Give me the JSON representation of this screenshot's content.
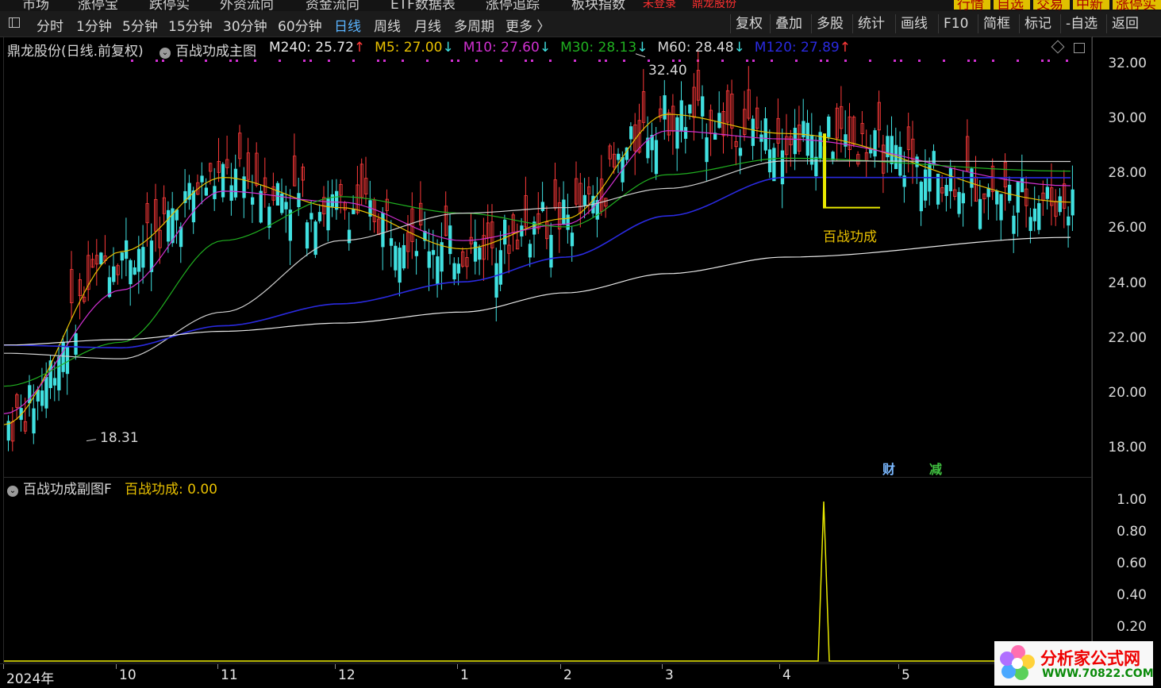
{
  "top_menu": {
    "items": [
      "市场",
      "涨停宝",
      "跌停实",
      "外资流向",
      "资金流向",
      "ETF数据表",
      "涨停追踪",
      "板块指数"
    ],
    "highlights": [
      "未登录",
      "鼎龙股份"
    ]
  },
  "top_right_tabs": [
    "行情",
    "自选",
    "交易",
    "中新",
    "涨停实"
  ],
  "toolbar": {
    "periods": [
      "分时",
      "1分钟",
      "5分钟",
      "15分钟",
      "30分钟",
      "60分钟",
      "日线",
      "周线",
      "月线",
      "多周期",
      "更多 〉"
    ],
    "active_period": "日线",
    "right_buttons": [
      "复权",
      "叠加",
      "多股",
      "统计",
      "画线",
      "F10",
      "简框",
      "标记",
      "-自选",
      "返回"
    ]
  },
  "main_chart": {
    "stock_label": "鼎龙股份(日线.前复权)",
    "indicator_name": "百战功成主图",
    "ma_values": [
      {
        "label": "M240: 25.72",
        "arrow": "↑",
        "color": "#e8e8e8"
      },
      {
        "label": "M5: 27.00",
        "arrow": "↓",
        "color": "#e8c000"
      },
      {
        "label": "M10: 27.60",
        "arrow": "↓",
        "color": "#d030d0"
      },
      {
        "label": "M30: 28.13",
        "arrow": "↓",
        "color": "#20b020"
      },
      {
        "label": "M60: 28.48",
        "arrow": "↓",
        "color": "#d8d8d8"
      },
      {
        "label": "M120: 27.89",
        "arrow": "↑",
        "color": "#2a2ae0"
      }
    ],
    "high_label": "32.40",
    "low_label": "18.31",
    "signal_label": "百战功成",
    "event_markers": [
      "财",
      "减"
    ],
    "y_ticks": [
      "32.00",
      "30.00",
      "28.00",
      "26.00",
      "24.00",
      "22.00",
      "20.00",
      "18.00"
    ]
  },
  "sub_chart": {
    "indicator_name": "百战功成副图F",
    "value_label": "百战功成: 0.00",
    "y_ticks": [
      "1.00",
      "0.80",
      "0.60",
      "0.40",
      "0.20"
    ]
  },
  "x_axis": {
    "labels": [
      "2024年",
      "10",
      "11",
      "12",
      "1",
      "2",
      "3",
      "4",
      "5"
    ]
  },
  "watermark": {
    "text": "分析家公式网",
    "url": "WWW.70822.COM"
  },
  "colors": {
    "up": "#ff3a3a",
    "down": "#40e0e0",
    "m5": "#e8c000",
    "m10": "#d030d0",
    "m30": "#20b020",
    "m60": "#cfcfcf",
    "m120": "#2a2ae0",
    "m240": "#e8e8e8",
    "signal": "#e8e800"
  },
  "chart_data": {
    "type": "line",
    "title": "鼎龙股份(日线.前复权)",
    "xlabel": "",
    "ylabel": "",
    "ylim": [
      17.0,
      33.0
    ],
    "x": [
      "2024-09",
      "2024-10",
      "2024-11",
      "2024-12",
      "2025-01",
      "2025-02",
      "2025-03",
      "2025-04",
      "2025-05"
    ],
    "series": [
      {
        "name": "M5",
        "values": [
          18.9,
          25.2,
          27.9,
          26.8,
          25.3,
          26.4,
          30.2,
          29.5,
          27.0
        ]
      },
      {
        "name": "M10",
        "values": [
          19.3,
          23.8,
          27.4,
          27.0,
          25.6,
          26.2,
          29.6,
          29.3,
          27.6
        ]
      },
      {
        "name": "M30",
        "values": [
          20.3,
          21.9,
          25.6,
          27.2,
          26.6,
          26.1,
          28.0,
          28.6,
          28.13
        ]
      },
      {
        "name": "M60",
        "values": [
          21.5,
          21.3,
          23.0,
          25.6,
          26.6,
          26.8,
          27.5,
          28.5,
          28.48
        ]
      },
      {
        "name": "M120",
        "values": [
          21.8,
          21.7,
          22.5,
          23.3,
          24.1,
          25.0,
          26.5,
          27.9,
          27.89
        ]
      },
      {
        "name": "M240",
        "values": [
          21.8,
          22.0,
          22.3,
          22.6,
          23.0,
          23.7,
          24.4,
          25.0,
          25.72
        ]
      }
    ],
    "sub_series": {
      "name": "百战功成",
      "baseline": 0.0,
      "spike_value": 1.0,
      "spike_at": "2025-04"
    },
    "high": 32.4,
    "low": 18.31
  }
}
